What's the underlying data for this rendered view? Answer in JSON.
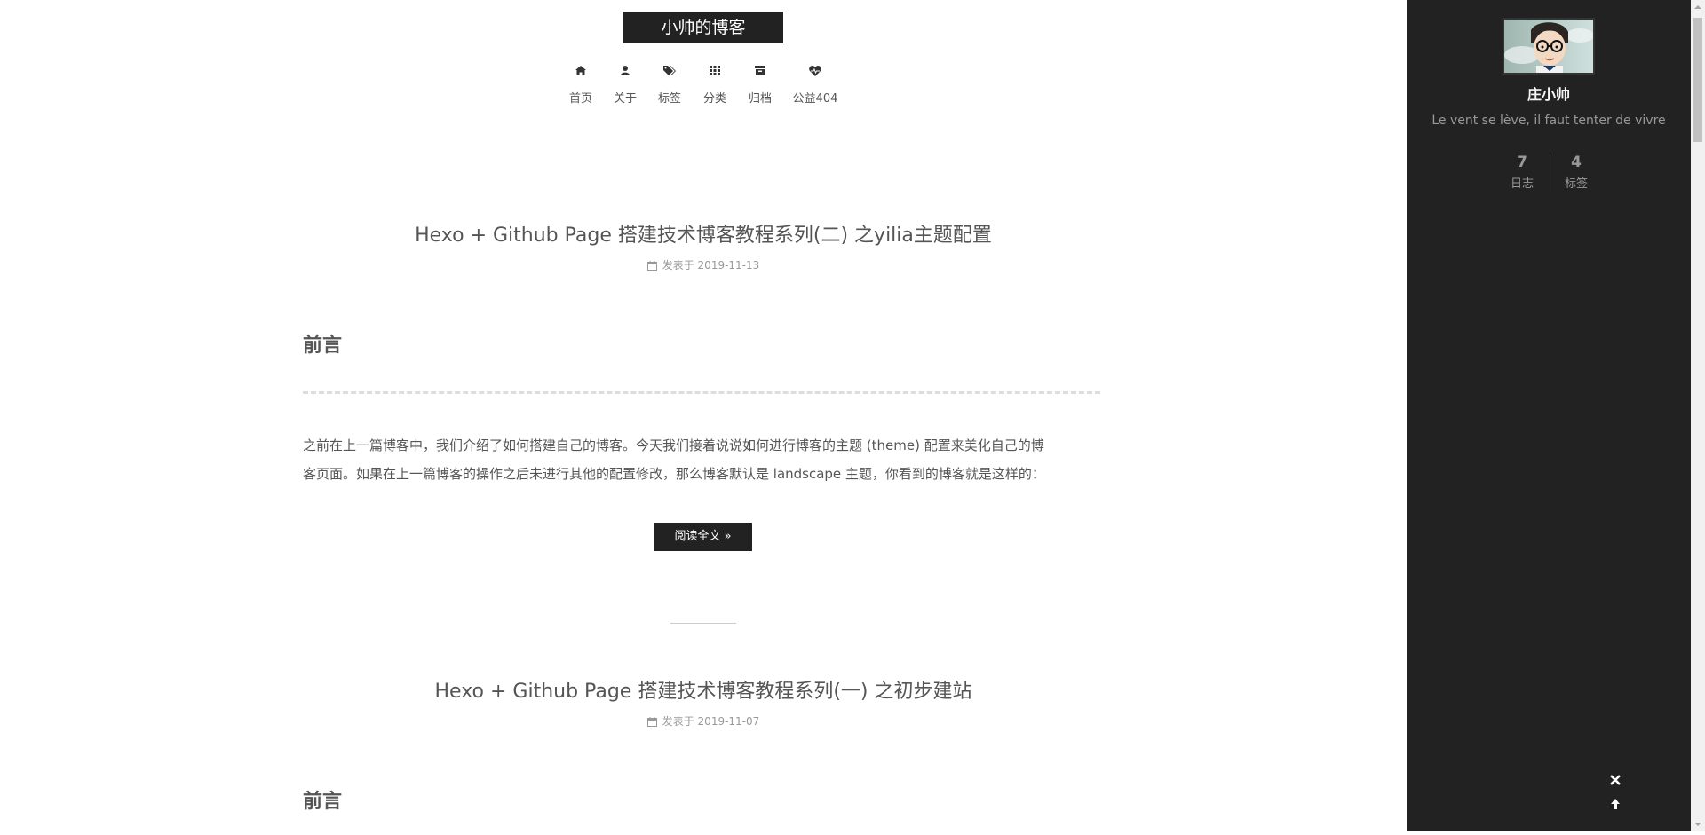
{
  "site": {
    "title": "小帅的博客"
  },
  "nav": {
    "items": [
      {
        "label": "首页",
        "icon": "home-icon"
      },
      {
        "label": "关于",
        "icon": "user-icon"
      },
      {
        "label": "标签",
        "icon": "tags-icon"
      },
      {
        "label": "分类",
        "icon": "grid-icon"
      },
      {
        "label": "归档",
        "icon": "archive-icon"
      },
      {
        "label": "公益404",
        "icon": "heartbeat-icon"
      }
    ]
  },
  "posts": [
    {
      "title": "Hexo + Github Page 搭建技术博客教程系列(二) 之yilia主题配置",
      "meta_prefix": "发表于",
      "date": "2019-11-13",
      "section_heading": "前言",
      "excerpt_line1": "之前在上一篇博客中，我们介绍了如何搭建自己的博客。今天我们接着说说如何进行博客的主题 (theme) 配置来美化自己的博",
      "excerpt_line2": "客页面。如果在上一篇博客的操作之后未进行其他的配置修改，那么博客默认是 landscape 主题，你看到的博客就是这样的：",
      "read_more": "阅读全文 »"
    },
    {
      "title": "Hexo + Github Page 搭建技术博客教程系列(一) 之初步建站",
      "meta_prefix": "发表于",
      "date": "2019-11-07",
      "section_heading": "前言"
    }
  ],
  "sidebar": {
    "author": "庄小帅",
    "motto": "Le vent se lève, il faut tenter de vivre",
    "stats": [
      {
        "count": "7",
        "label": "日志"
      },
      {
        "count": "4",
        "label": "标签"
      }
    ]
  },
  "colors": {
    "brand_bg": "#222222",
    "sidebar_bg": "#222222",
    "text": "#555555",
    "muted": "#999999"
  }
}
